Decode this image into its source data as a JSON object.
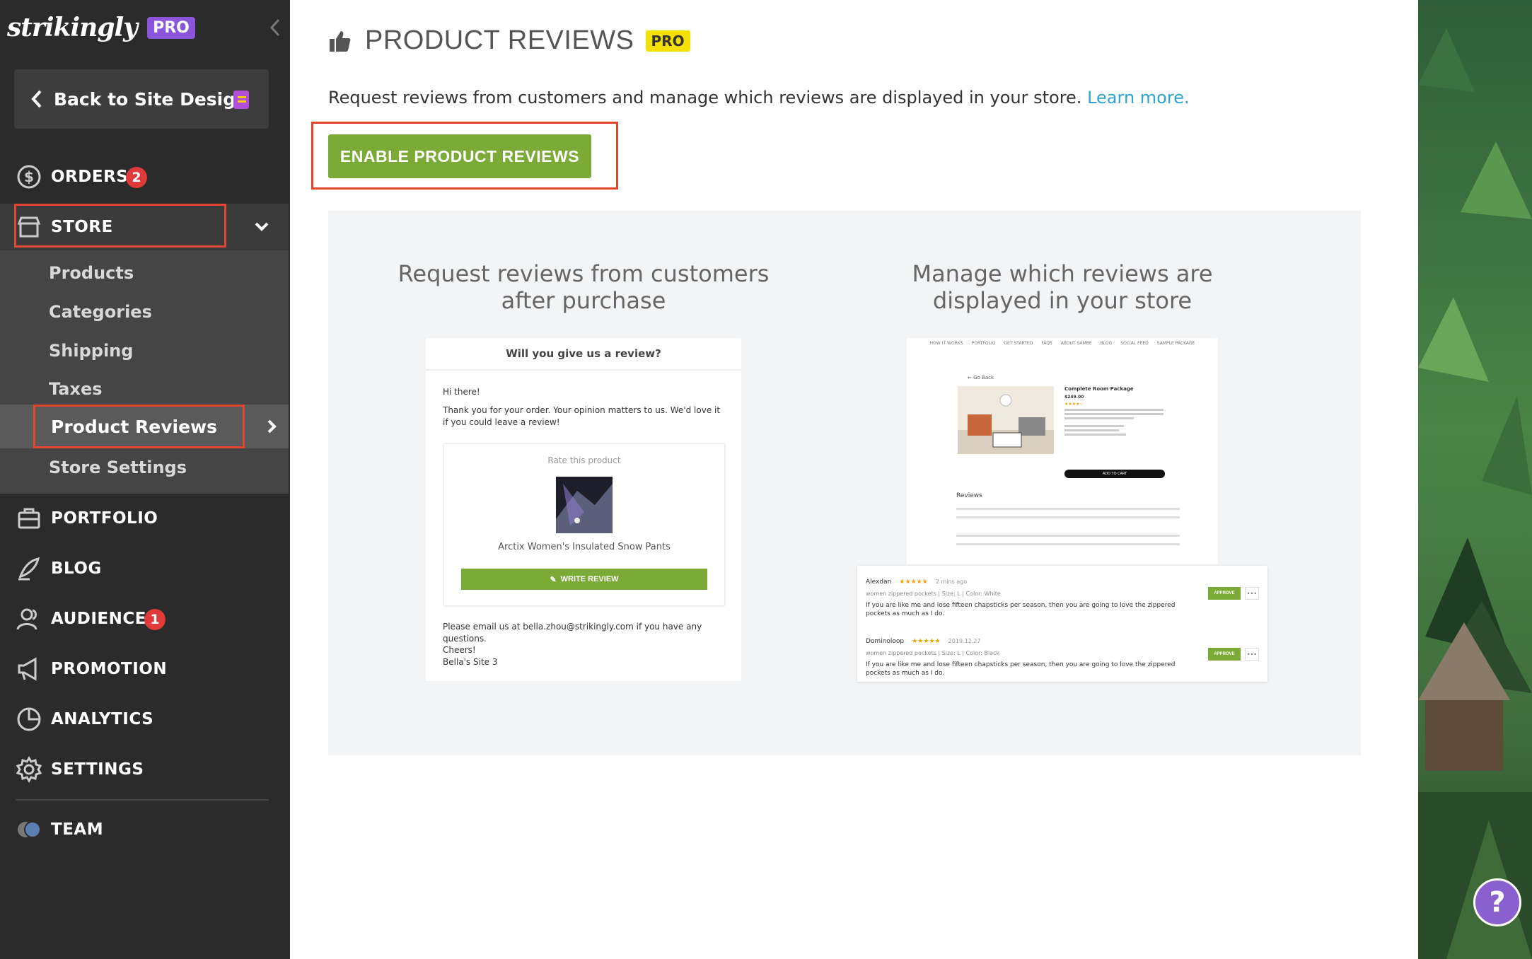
{
  "brand": {
    "logo": "strikingly",
    "pro": "PRO"
  },
  "sidebar": {
    "back_label": "Back to Site Design",
    "orders": {
      "label": "ORDERS",
      "badge": "2"
    },
    "store": {
      "label": "STORE",
      "sub_items": [
        "Products",
        "Categories",
        "Shipping",
        "Taxes",
        "Product Reviews",
        "Store Settings"
      ]
    },
    "portfolio": "PORTFOLIO",
    "blog": "BLOG",
    "audience": {
      "label": "AUDIENCE",
      "badge": "1"
    },
    "promotion": "PROMOTION",
    "analytics": "ANALYTICS",
    "settings": "SETTINGS",
    "team": "TEAM"
  },
  "main": {
    "title": "PRODUCT REVIEWS",
    "pro_tag": "PRO",
    "description": "Request reviews from customers and manage which reviews are displayed in your store.",
    "learn_more": "Learn more.",
    "enable_button": "ENABLE PRODUCT REVIEWS",
    "feature_left_heading": "Request reviews from customers after purchase",
    "feature_right_heading": "Manage which reviews are displayed in your store"
  },
  "email_mock": {
    "heading": "Will you give us a review?",
    "greeting": "Hi there!",
    "body": "Thank you for your order. Your opinion matters to us. We'd love it if you could leave a review!",
    "rate_title": "Rate this product",
    "product_name": "Arctix Women's Insulated Snow Pants",
    "write_button": "WRITE REVIEW",
    "footer": "Please email us at bella.zhou@strikingly.com if you have any questions.",
    "signoff": "Cheers!",
    "site": "Bella's Site 3"
  },
  "store_mock": {
    "nav": [
      "HOW IT WORKS",
      "PORTFOLIO",
      "GET STARTED",
      "FAQS",
      "ABOUT SAMBE",
      "BLOG",
      "SOCIAL FEED",
      "SAMPLE PACKAGE"
    ],
    "back": "← Go Back",
    "product_title": "Complete Room Package",
    "price": "$249.00",
    "add_to_cart": "ADD TO CART",
    "reviews_heading": "Reviews"
  },
  "reviews": [
    {
      "name": "Alexdan",
      "stars": "★★★★★",
      "time": "2 mins ago",
      "meta": "women zippered pockets  |  Size: L  |  Color: White",
      "body": "If you are like me and lose fifteen chapsticks per season, then you are going to love the zippered pockets as much as I do.",
      "approve": "APPROVE"
    },
    {
      "name": "Dominoloop",
      "stars": "★★★★★",
      "time": "2019.12.27",
      "meta": "women zippered pockets  |  Size: L  |  Color: Black",
      "body": "If you are like me and lose fifteen chapsticks per season, then you are going to love the zippered pockets as much as I do.",
      "approve": "APPROVE"
    }
  ],
  "help": "?",
  "colors": {
    "accent_green": "#7bab36",
    "sidebar_bg": "#2b2b2b",
    "highlight_red": "#e3462e",
    "pro_purple": "#8a55d8",
    "pro_yellow": "#f5e100",
    "link_blue": "#2ea3d0"
  }
}
